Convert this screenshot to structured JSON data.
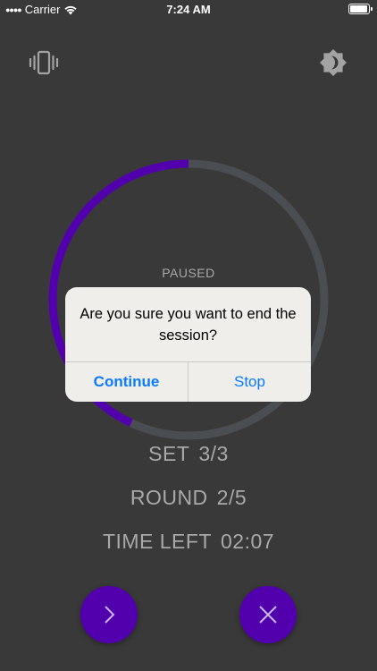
{
  "status_bar": {
    "carrier": "Carrier",
    "time": "7:24 AM"
  },
  "toolbar": {
    "vibration_icon": "vibration-icon",
    "theme_icon": "brightness-icon"
  },
  "timer": {
    "state_label": "PAUSED",
    "progress_fraction": 0.5,
    "progress_color": "#5200ad",
    "track_color": "#4a4d52"
  },
  "stats": {
    "set_label": "SET",
    "set_value": "3/3",
    "round_label": "ROUND",
    "round_value": "2/5",
    "time_left_label": "TIME LEFT",
    "time_left_value": "02:07"
  },
  "controls": {
    "next_icon": "chevron-right-icon",
    "stop_icon": "close-icon",
    "button_color": "#5200ad"
  },
  "dialog": {
    "message": "Are you sure you want to end the session?",
    "continue_label": "Continue",
    "stop_label": "Stop",
    "action_color": "#0a7aff"
  }
}
